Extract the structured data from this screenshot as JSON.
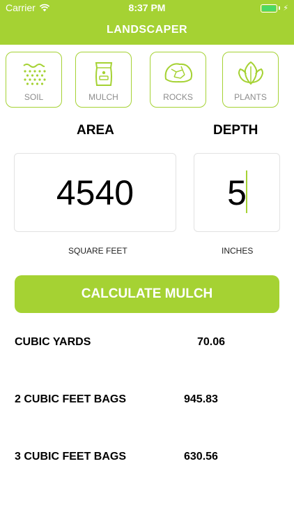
{
  "status_bar": {
    "carrier": "Carrier",
    "time": "8:37 PM",
    "wifi_icon": "wifi-icon",
    "battery_icon": "battery-icon"
  },
  "header": {
    "title": "LANDSCAPER"
  },
  "categories": [
    {
      "label": "SOIL",
      "icon": "soil-icon"
    },
    {
      "label": "MULCH",
      "icon": "mulch-bag-icon"
    },
    {
      "label": "ROCKS",
      "icon": "rocks-icon"
    },
    {
      "label": "PLANTS",
      "icon": "plant-leaf-icon"
    }
  ],
  "area": {
    "label": "AREA",
    "value": "4540",
    "unit": "SQUARE FEET"
  },
  "depth": {
    "label": "DEPTH",
    "value": "5",
    "unit": "INCHES"
  },
  "calculate_button": {
    "label": "CALCULATE MULCH"
  },
  "results": [
    {
      "label": "CUBIC YARDS",
      "value": "70.06"
    },
    {
      "label": "2 CUBIC FEET BAGS",
      "value": "945.83"
    },
    {
      "label": "3 CUBIC FEET BAGS",
      "value": "630.56"
    }
  ],
  "colors": {
    "accent": "#a5d233",
    "icon": "#a5d233",
    "label_gray": "#8c8c8c"
  }
}
